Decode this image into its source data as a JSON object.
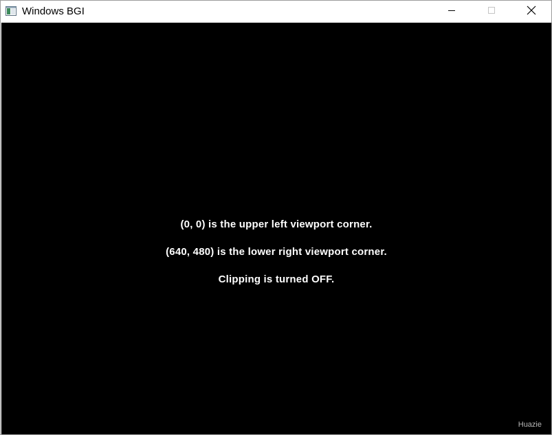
{
  "window": {
    "title": "Windows BGI",
    "app_icon": "window-app-icon",
    "controls": {
      "minimize_icon": "minimize-icon",
      "maximize_icon": "maximize-icon",
      "close_icon": "close-icon"
    }
  },
  "canvas": {
    "background": "#000000",
    "text_color": "#ffffff",
    "lines": [
      "(0, 0) is the upper left viewport corner.",
      "(640, 480) is the lower right viewport corner.",
      "Clipping is turned OFF."
    ],
    "watermark": "Huazie"
  }
}
